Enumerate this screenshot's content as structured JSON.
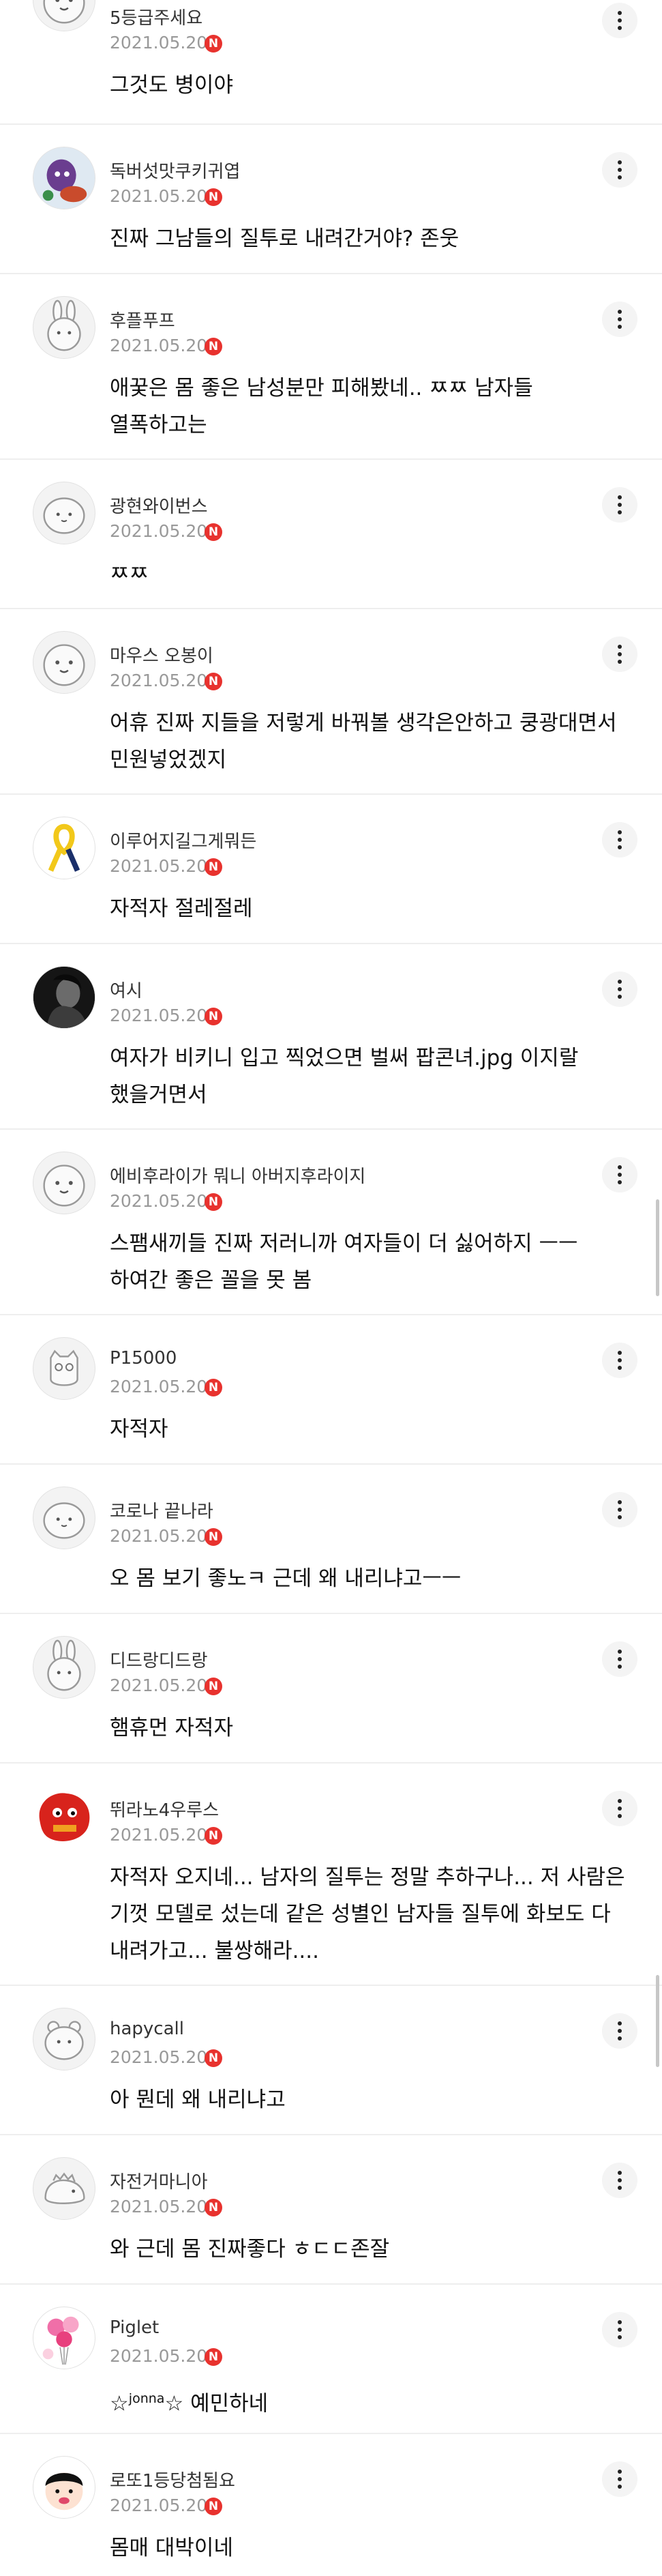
{
  "colors": {
    "accent": "#e8322e",
    "meta": "#999999",
    "text": "#111111",
    "divider": "#eeeeee"
  },
  "badge_label": "N",
  "comments": [
    {
      "nickname": "5등급주세요",
      "date": "2021.05.20",
      "has_new": true,
      "text": "그것도 병이야",
      "avatar_icon": "baby-mascot-icon"
    },
    {
      "nickname": "독버섯맛쿠키귀엽",
      "date": "2021.05.20",
      "has_new": true,
      "text": "진짜 그남들의 질투로 내려간거야? 존웃",
      "avatar_icon": "cookie-character-icon"
    },
    {
      "nickname": "후플푸프",
      "date": "2021.05.20",
      "has_new": true,
      "text": "애꿎은 몸 좋은 남성분만 피해봤네.. ㅉㅉ 남자들\n열폭하고는",
      "avatar_icon": "rabbit-mascot-icon"
    },
    {
      "nickname": "광현와이번스",
      "date": "2021.05.20",
      "has_new": true,
      "text": "ㅉㅉ",
      "avatar_icon": "blob-mascot-icon"
    },
    {
      "nickname": "마우스 오봉이",
      "date": "2021.05.20",
      "has_new": true,
      "text": "어휴 진짜 지들을 저렇게 바꿔볼 생각은안하고 쿵광대면서\n민원넣었겠지",
      "avatar_icon": "baby-mascot-icon"
    },
    {
      "nickname": "이루어지길그게뭐든",
      "date": "2021.05.20",
      "has_new": true,
      "text": "자적자 절레절레",
      "avatar_icon": "yellow-ribbon-icon"
    },
    {
      "nickname": "여시",
      "date": "2021.05.20",
      "has_new": true,
      "text": "여자가 비키니 입고 찍었으면 벌써 팝콘녀.jpg 이지랄\n했을거면서",
      "avatar_icon": "dark-photo-icon"
    },
    {
      "nickname": "에비후라이가 뭐니 아버지후라이지",
      "date": "2021.05.20",
      "has_new": true,
      "text": "스팸새끼들 진짜 저러니까 여자들이 더 싫어하지 ㅡㅡ\n하여간 좋은 꼴을 못 봄",
      "avatar_icon": "baby-mascot-icon"
    },
    {
      "nickname": "P15000",
      "date": "2021.05.20",
      "has_new": true,
      "text": "자적자",
      "avatar_icon": "owl-mascot-icon"
    },
    {
      "nickname": "코로나 끝나라",
      "date": "2021.05.20",
      "has_new": true,
      "text": "오 몸 보기 좋노ㅋ 근데 왜 내리냐고ㅡㅡ",
      "avatar_icon": "blob-mascot-icon"
    },
    {
      "nickname": "디드랑디드랑",
      "date": "2021.05.20",
      "has_new": true,
      "text": "햄휴먼 자적자",
      "avatar_icon": "rabbit-mascot-icon"
    },
    {
      "nickname": "뛰라노4우루스",
      "date": "2021.05.20",
      "has_new": true,
      "text": "자적자 오지네... 남자의 질투는 정말 추하구나... 저 사람은\n기껏 모델로 섰는데 같은 성별인 남자들 질투에 화보도 다\n내려가고... 불쌍해라....",
      "avatar_icon": "red-monster-icon"
    },
    {
      "nickname": "hapycall",
      "date": "2021.05.20",
      "has_new": true,
      "text": "아 뭔데 왜 내리냐고",
      "avatar_icon": "hamster-mascot-icon"
    },
    {
      "nickname": "자전거마니아",
      "date": "2021.05.20",
      "has_new": true,
      "text": "와 근데 몸 진짜좋다 ㅎㄷㄷ존잘",
      "avatar_icon": "dino-mascot-icon"
    },
    {
      "nickname": "Piglet",
      "date": "2021.05.20",
      "has_new": true,
      "text_prefix": "☆",
      "text_sup": "jonna",
      "text_suffix": "☆ 예민하네",
      "avatar_icon": "pink-balloons-icon"
    },
    {
      "nickname": "로또1등당첨됨요",
      "date": "2021.05.20",
      "has_new": true,
      "text": "몸매 대박이네",
      "avatar_icon": "cartoon-face-icon"
    }
  ]
}
